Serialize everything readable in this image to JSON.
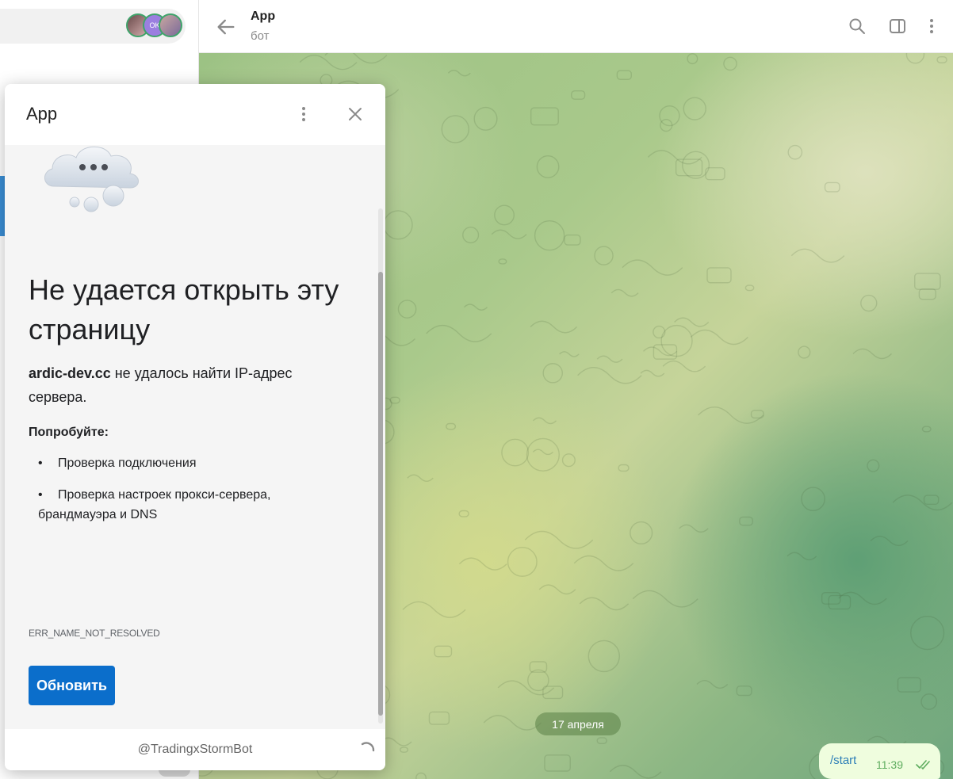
{
  "chat": {
    "title": "App",
    "subtitle": "бот",
    "date_separator": "17 апреля",
    "messages": [
      {
        "text": "/start",
        "time": "11:39",
        "status": "read"
      }
    ]
  },
  "sidebar": {
    "story_avatars": [
      {
        "initials": ""
      },
      {
        "initials": "OK"
      },
      {
        "initials": ""
      }
    ]
  },
  "popup": {
    "title": "App",
    "footer_username": "@TradingxStormBot",
    "error_page": {
      "heading": "Не удается открыть эту страницу",
      "domain": "ardic-dev.cc",
      "message_rest": " не удалось найти IP-адрес сервера.",
      "try_heading": "Попробуйте:",
      "suggestions": [
        "Проверка подключения",
        "Проверка настроек прокси-сервера, брандмауэра и DNS"
      ],
      "error_code": "ERR_NAME_NOT_RESOLVED",
      "reload_label": "Обновить"
    }
  },
  "colors": {
    "accent": "#0b6ecb",
    "outgoing_bubble": "#effdde",
    "date_pill": "#7a9c5e",
    "active_strip": "#3a8fd6"
  }
}
